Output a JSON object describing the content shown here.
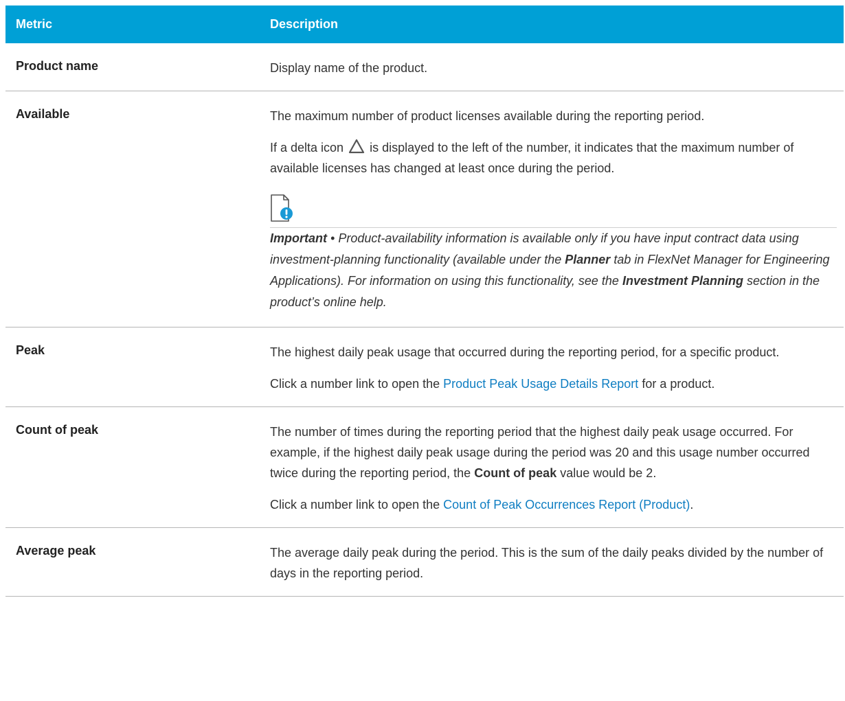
{
  "header": {
    "col_metric": "Metric",
    "col_description": "Description"
  },
  "rows": {
    "product_name": {
      "metric": "Product name",
      "p1": "Display name of the product."
    },
    "available": {
      "metric": "Available",
      "p1": "The maximum number of product licenses available during the reporting period.",
      "p2_before": "If a delta icon",
      "p2_after": "is displayed to the left of the number, it indicates that the maximum number of available licenses has changed at least once during the period.",
      "note_label": "Important",
      "note_bullet": "•",
      "note_t1": "Product-availability information is available only if you have input contract data using investment-planning functionality (available under the",
      "note_b1": "Planner",
      "note_t2": "tab in FlexNet Manager for Engineering Applications). For information on using this functionality, see the",
      "note_b2": "Investment Planning",
      "note_t3": "section in the product’s online help."
    },
    "peak": {
      "metric": "Peak",
      "p1": "The highest daily peak usage that occurred during the reporting period, for a specific product.",
      "p2_before": "Click a number link to open the",
      "p2_link": "Product Peak Usage Details Report",
      "p2_after": "for a product."
    },
    "count_of_peak": {
      "metric": "Count of peak",
      "p1_t1": "The number of times during the reporting period that the highest daily peak usage occurred. For example, if the highest daily peak usage during the period was 20 and this usage number occurred twice during the reporting period, the",
      "p1_b": "Count of peak",
      "p1_t2": "value would be 2.",
      "p2_before": "Click a number link to open the",
      "p2_link": "Count of Peak Occurrences Report (Product)",
      "p2_after": "."
    },
    "average_peak": {
      "metric": "Average peak",
      "p1": "The average daily peak during the period. This is the sum of the daily peaks divided by the number of days in the reporting period."
    }
  },
  "icons": {
    "delta": "delta-icon",
    "note": "important-note-icon"
  },
  "colors": {
    "header_bg": "#00a0d6",
    "link": "#0f7ec2",
    "note_accent": "#1a9ad6"
  }
}
